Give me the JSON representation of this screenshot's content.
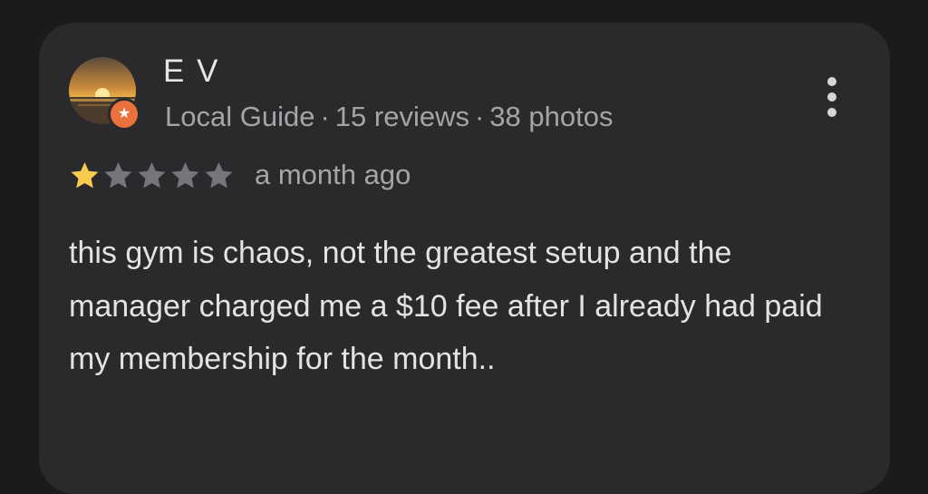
{
  "review": {
    "author_name": "E V",
    "author_role": "Local Guide",
    "review_count": "15 reviews",
    "photo_count": "38 photos",
    "separator": "·",
    "rating": 1,
    "rating_max": 5,
    "time_ago": "a month ago",
    "text": "this gym is chaos, not the greatest setup and the manager charged me a $10 fee after I already had paid my membership for the month..",
    "avatar_icon": "sunset-avatar",
    "badge_icon": "local-guide-star-icon",
    "menu_icon": "more-vert-icon"
  },
  "colors": {
    "background": "#1b1b1c",
    "card": "#2a2a2c",
    "star_filled": "#f7cb4d",
    "star_empty": "#76767a",
    "badge": "#e8713c",
    "text_primary": "#e3e3e3",
    "text_secondary": "#a5a5a8"
  }
}
